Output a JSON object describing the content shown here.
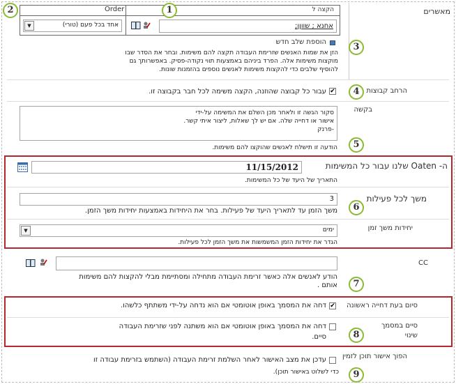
{
  "approvers": {
    "label": "מאשרים",
    "header_assign": "הקצה ל",
    "header_order": "Order",
    "person_value": "אחנא ; שווןן;",
    "order_value": "אחד בכל פעם (טורי)"
  },
  "add_stage": {
    "label": "הוספת שלב חדש",
    "description": "הזן את שמות האנשים שזרימת העבודה תקצה להם משימות. ובחר את הסדר שבו מוקצות משימות אלה. הפרד ביניהם באמצעות תווי נקודה-פסיק. באפשרותך גם להוסיף שלבים כדי להקצות משימות לאנשים נוספים בהזמנות שונות."
  },
  "expand_groups": {
    "label": "הרחב קבוצות",
    "option": "עבור כל קבוצה שהוזנה, הקצה משימה לכל חבר בקבוצה זו."
  },
  "request": {
    "label": "בקשה",
    "value": "סקור הגשה זו ולאחר מכן השלם את המשימה על-ידי אישור או דחייה שלה. אם יש לך שאלות, ליצור איתי קשר. -פרנק",
    "hint": "הודעה זו תישלח לאנשים שהוקצו להם משימות."
  },
  "due_date": {
    "label": "ה- Oaten שלנו עבור כל המשימות",
    "value": "11/15/2012",
    "hint": "התאריך של היעד של כל המשימות."
  },
  "duration": {
    "label": "משך לכל פעילות",
    "value": "3",
    "hint": "משך הזמן עד לתאריך היעד של פעילות. בחר את היחידות באמצעות יחידות משך הזמן."
  },
  "duration_units": {
    "label": "יחידות משך זמן",
    "value": "ימים",
    "hint": "הגדר את יחידות הזמן המשמשות את משך הזמן לכל פעילות."
  },
  "cc": {
    "label": "CC",
    "hint": "הודע לאנשים אלה כאשר זרימת העבודה מתחילה ומסתיימת מבלי להקצות להם משימות אותם ."
  },
  "end_first_reject": {
    "label": "סיום בעת דחייה ראשונה",
    "option": "דחה את המסמך באופן אוטומטי אם הוא נדחה על-ידי משתתף כלשהו."
  },
  "end_doc_change": {
    "label": "סיים במסמך",
    "label2": "שינוי",
    "option": "דחה את המסמך באופן אוטומטי אם הוא משתנה לפני שזרימת העבודה",
    "option2": "סיים."
  },
  "content_approval": {
    "label": "הפוך אישור תוכן לזמין",
    "option": "עדכן את מצב האישור לאחר השלמת זרימת העבודה (השתמש בזרימת עבודה זו",
    "option2": "כדי לשלוט באישור תוכן)."
  },
  "callouts": [
    "1",
    "2",
    "3",
    "4",
    "5",
    "6",
    "7",
    "8",
    "9"
  ]
}
